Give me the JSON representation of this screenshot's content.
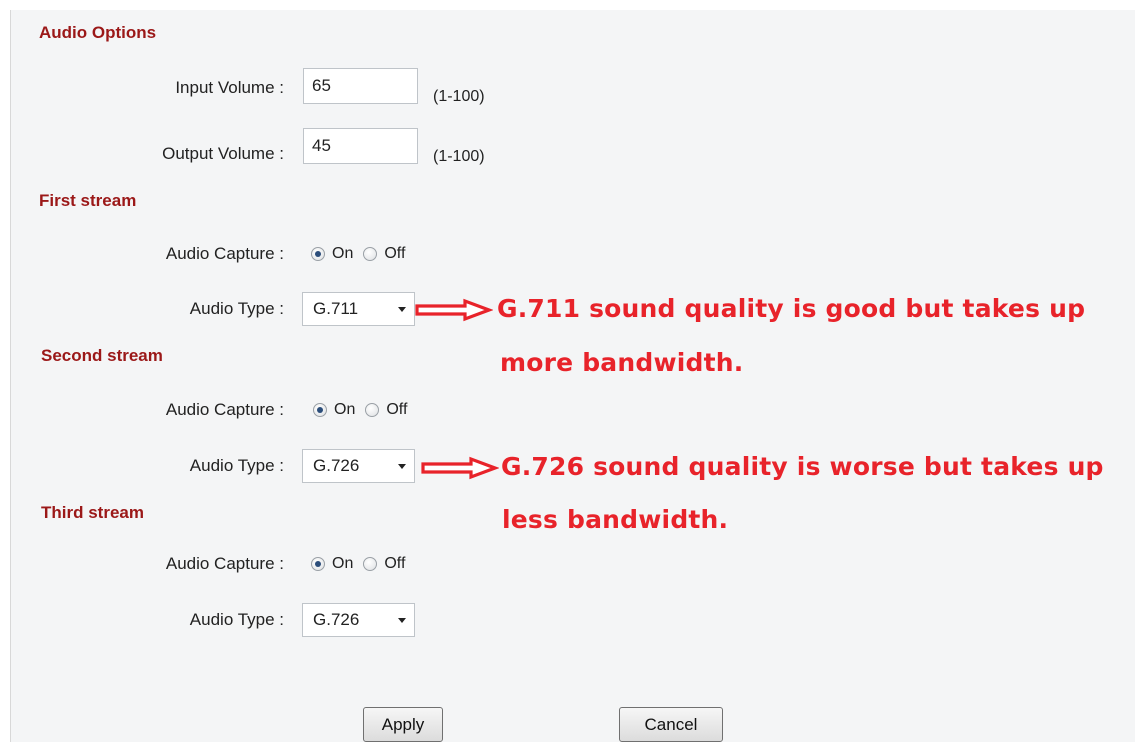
{
  "audio_options": {
    "title": "Audio Options",
    "input_volume": {
      "label": "Input Volume :",
      "value": "65",
      "range": "(1-100)"
    },
    "output_volume": {
      "label": "Output Volume :",
      "value": "45",
      "range": "(1-100)"
    }
  },
  "streams": [
    {
      "title": "First stream",
      "capture_label": "Audio Capture :",
      "on_label": "On",
      "off_label": "Off",
      "capture": "On",
      "type_label": "Audio Type :",
      "type_value": "G.711"
    },
    {
      "title": "Second stream",
      "capture_label": "Audio Capture :",
      "on_label": "On",
      "off_label": "Off",
      "capture": "On",
      "type_label": "Audio Type :",
      "type_value": "G.726"
    },
    {
      "title": "Third stream",
      "capture_label": "Audio Capture :",
      "on_label": "On",
      "off_label": "Off",
      "capture": "On",
      "type_label": "Audio Type :",
      "type_value": "G.726"
    }
  ],
  "annotations": [
    {
      "line1": "G.711 sound quality is good but takes up",
      "line2": "more bandwidth."
    },
    {
      "line1": "G.726 sound quality is worse but takes up",
      "line2": "less bandwidth."
    }
  ],
  "buttons": {
    "apply": "Apply",
    "cancel": "Cancel"
  },
  "colors": {
    "section_title": "#9b1818",
    "annotation": "#e8232a",
    "panel_background": "#f4f5f6"
  },
  "icons": {
    "annotation_arrow": "outline-right-arrow-icon",
    "select_caret": "chevron-down-icon"
  }
}
